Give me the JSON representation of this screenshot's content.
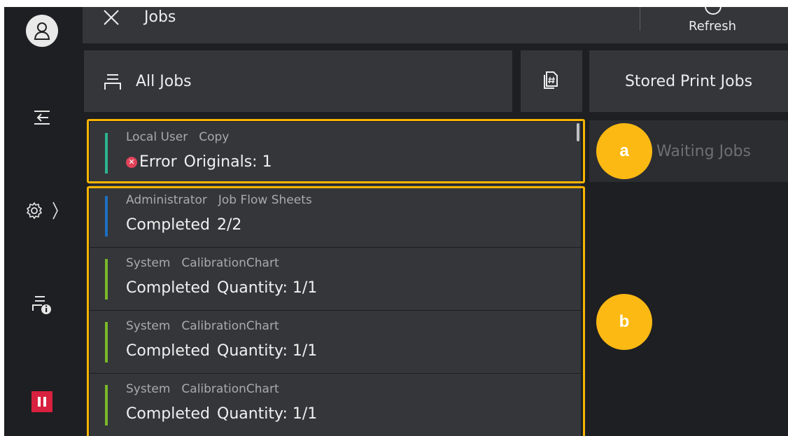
{
  "header": {
    "title": "Jobs",
    "refresh_label": "Refresh",
    "close_icon": "close-icon",
    "refresh_icon": "refresh-icon"
  },
  "sidebar": {
    "items": [
      {
        "name": "user-icon"
      },
      {
        "name": "job-log-icon"
      },
      {
        "name": "settings-icon",
        "has_chevron": true
      },
      {
        "name": "printer-info-icon"
      },
      {
        "name": "pause-icon"
      }
    ]
  },
  "toolbar": {
    "all_jobs_label": "All Jobs",
    "stored_print_jobs_label": "Stored Print Jobs",
    "waiting_jobs_label": "Waiting Jobs"
  },
  "jobs": [
    {
      "owner": "Local User",
      "type": "Copy",
      "status": "Error",
      "detail": "Originals: 1",
      "bar_color": "#2db38f",
      "error": true
    },
    {
      "owner": "Administrator",
      "type": "Job Flow Sheets",
      "status": "Completed",
      "detail": "2/2",
      "bar_color": "#1e6fbf",
      "error": false
    },
    {
      "owner": "System",
      "type": "CalibrationChart",
      "status": "Completed",
      "detail": "Quantity: 1/1",
      "bar_color": "#7ab828",
      "error": false
    },
    {
      "owner": "System",
      "type": "CalibrationChart",
      "status": "Completed",
      "detail": "Quantity: 1/1",
      "bar_color": "#7ab828",
      "error": false
    },
    {
      "owner": "System",
      "type": "CalibrationChart",
      "status": "Completed",
      "detail": "Quantity: 1/1",
      "bar_color": "#7ab828",
      "error": false
    }
  ],
  "callouts": {
    "a": "a",
    "b": "b",
    "color": "#f8b400"
  },
  "colors": {
    "background": "#1e1f22",
    "panel": "#34363a",
    "pause": "#d8203f",
    "error": "#e0435a"
  }
}
